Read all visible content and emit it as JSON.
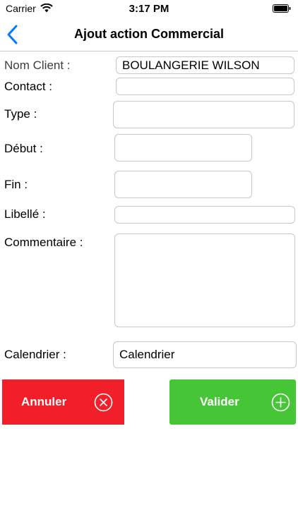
{
  "status_bar": {
    "carrier": "Carrier",
    "time": "3:17 PM"
  },
  "nav": {
    "title": "Ajout action Commercial",
    "back_icon": "chevron-left-icon"
  },
  "form": {
    "client_label": "Nom Client :",
    "client_value": "BOULANGERIE WILSON",
    "contact_label": "Contact :",
    "contact_value": "",
    "type_label": "Type :",
    "type_value": "",
    "debut_label": "Début :",
    "debut_value": "",
    "fin_label": "Fin :",
    "fin_value": "",
    "libelle_label": "Libellé :",
    "libelle_value": "",
    "commentaire_label": "Commentaire :",
    "commentaire_value": "",
    "calendrier_label": "Calendrier :",
    "calendrier_value": "Calendrier"
  },
  "actions": {
    "cancel_label": "Annuler",
    "cancel_icon": "circle-x-icon",
    "cancel_color": "#f21f2a",
    "validate_label": "Valider",
    "validate_icon": "circle-plus-icon",
    "validate_color": "#46c537"
  },
  "colors": {
    "accent": "#007aff"
  }
}
